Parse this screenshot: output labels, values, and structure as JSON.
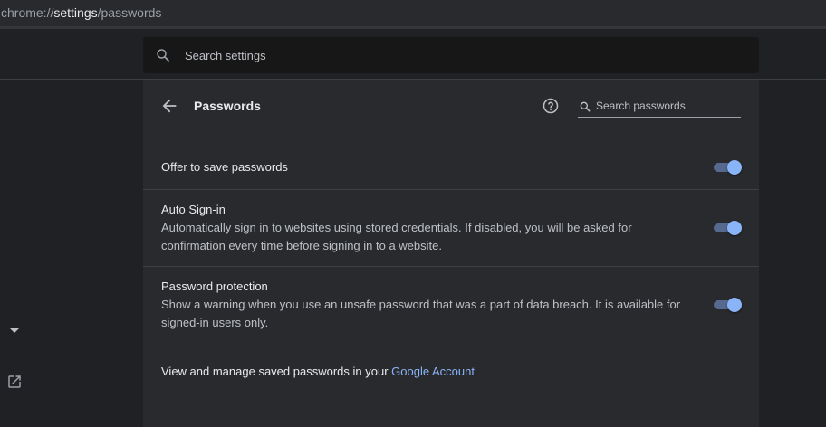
{
  "address_bar": {
    "scheme": "chrome://",
    "host": "settings",
    "path": "/passwords"
  },
  "top_search": {
    "placeholder": "Search settings",
    "icon": "search-icon"
  },
  "sidebar": {
    "icons": [
      "chevron-down-icon",
      "open-in-new-icon"
    ]
  },
  "passwords_page": {
    "title": "Passwords",
    "back_icon": "arrow-back-icon",
    "help_icon": "help-icon",
    "search_placeholder": "Search passwords",
    "settings": [
      {
        "title": "Offer to save passwords",
        "description": "",
        "enabled": true
      },
      {
        "title": "Auto Sign-in",
        "description": "Automatically sign in to websites using stored credentials. If disabled, you will be asked for confirmation every time before signing in to a website.",
        "enabled": true
      },
      {
        "title": "Password protection",
        "description": "Show a warning when you use an unsafe password that was a part of data breach. It is available for signed-in users only.",
        "enabled": true
      }
    ],
    "manage_text": "View and manage saved passwords in your ",
    "manage_link": "Google Account"
  },
  "colors": {
    "background": "#202124",
    "card": "#292a2d",
    "accent": "#8ab4f8",
    "toggle_track": "#56698f"
  }
}
